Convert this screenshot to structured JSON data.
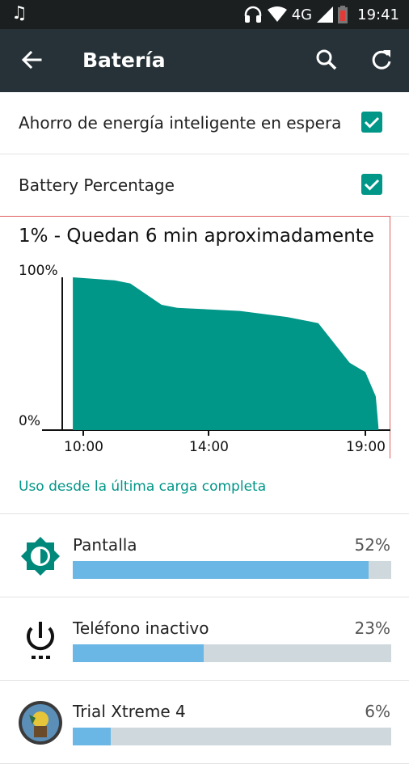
{
  "status_bar": {
    "network": "4G",
    "time": "19:41",
    "icons": [
      "music-note-icon",
      "headset-icon",
      "wifi-icon",
      "signal-icon",
      "battery-low-icon"
    ]
  },
  "toolbar": {
    "title": "Batería",
    "icons": [
      "back-arrow-icon",
      "search-icon",
      "refresh-icon"
    ]
  },
  "settings": [
    {
      "label": "Ahorro de energía inteligente en espera",
      "checked": true
    },
    {
      "label": "Battery Percentage",
      "checked": true
    }
  ],
  "battery_graph": {
    "estimate": "1% - Quedan 6 min aproximadamente",
    "y_max_label": "100%",
    "y_min_label": "0%",
    "x_labels": [
      "10:00",
      "14:00",
      "19:00"
    ],
    "fill_color": "#009688"
  },
  "chart_data": {
    "type": "area",
    "x": [
      "09:40",
      "11:00",
      "11:30",
      "12:30",
      "13:00",
      "15:00",
      "16:30",
      "17:30",
      "18:00",
      "18:30",
      "19:00",
      "19:20",
      "19:25"
    ],
    "values": [
      100,
      98,
      96,
      82,
      80,
      78,
      74,
      70,
      57,
      44,
      38,
      22,
      2
    ],
    "ylim": [
      0,
      100
    ],
    "color": "#009688"
  },
  "usage_link": "Uso desde la última carga completa",
  "usage_items": [
    {
      "name": "Pantalla",
      "percent_text": "52%",
      "bar_fraction": 0.93,
      "icon": "brightness-icon"
    },
    {
      "name": "Teléfono inactivo",
      "percent_text": "23%",
      "bar_fraction": 0.41,
      "icon": "power-standby-icon"
    },
    {
      "name": "Trial Xtreme 4",
      "percent_text": "6%",
      "bar_fraction": 0.12,
      "icon": "game-app-icon"
    }
  ],
  "colors": {
    "accent": "#009688",
    "toolbar": "#263238",
    "usage_bar": "#6ab7e5",
    "usage_track": "#cfd8dc"
  }
}
